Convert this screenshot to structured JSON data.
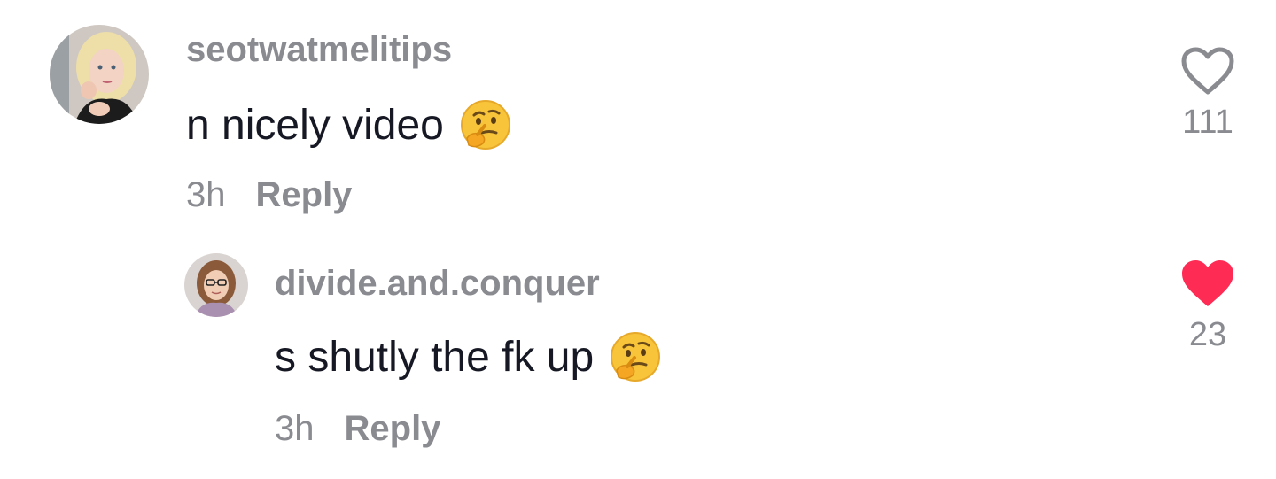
{
  "comments": [
    {
      "username": "seotwatmelitips",
      "text": "n nicely video",
      "emoji": "thinking-face-emoji",
      "time": "3h",
      "reply_label": "Reply",
      "likes": "111",
      "liked": false
    },
    {
      "username": "divide.and.conquer",
      "text": "s shutly the fk up",
      "emoji": "thinking-face-emoji",
      "time": "3h",
      "reply_label": "Reply",
      "likes": "23",
      "liked": true
    }
  ],
  "colors": {
    "text": "#161823",
    "muted": "#8a8b91",
    "liked_heart": "#fe2c55",
    "unliked_heart": "#8a8b91"
  },
  "icons": {
    "heart_outline": "heart-outline-icon",
    "heart_filled": "heart-filled-icon"
  }
}
